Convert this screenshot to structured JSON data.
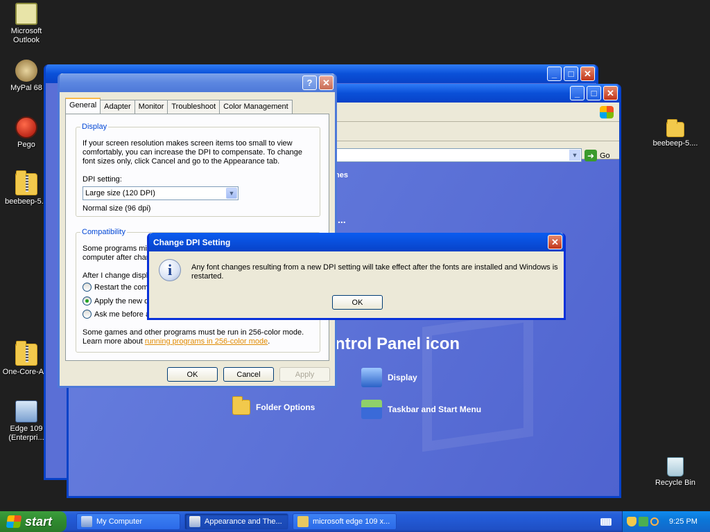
{
  "desktop": {
    "icons": [
      {
        "label": "Microsoft Outlook"
      },
      {
        "label": "MyPal 68"
      },
      {
        "label": "Pego"
      },
      {
        "label": "beebeep-5..."
      },
      {
        "label": "One-Core-A..."
      },
      {
        "label": "Edge 109 (Enterpri..."
      },
      {
        "label": "beebeep-5...."
      },
      {
        "label": "Recycle Bin"
      }
    ]
  },
  "control_panel": {
    "go_label": "Go",
    "small_heading_fragment": "nes",
    "dots": "...",
    "heading_fragment": "ntrol Panel icon",
    "links": {
      "display": "Display",
      "folder_options": "Folder Options",
      "taskbar_start": "Taskbar and Start Menu"
    }
  },
  "display_dialog": {
    "tabs": [
      "General",
      "Adapter",
      "Monitor",
      "Troubleshoot",
      "Color Management"
    ],
    "display_group": {
      "legend": "Display",
      "description": "If your screen resolution makes screen items too small to view comfortably, you can increase the DPI to compensate.  To change font sizes only, click Cancel and go to the Appearance tab.",
      "dpi_label": "DPI setting:",
      "dpi_value": "Large size (120 DPI)",
      "dpi_note": "Normal size (96 dpi)"
    },
    "compat_group": {
      "legend": "Compatibility",
      "line1": "Some programs migh",
      "line2": "computer after chan",
      "after_change": "After I change displa",
      "radio1": "Restart the comp",
      "radio2": "Apply the new di",
      "radio3": "Ask me before ap",
      "games_text": "Some games and other programs must be run in 256-color mode.",
      "learn_more_prefix": "Learn more about ",
      "learn_more_link": "running programs in 256-color mode",
      "learn_more_suffix": "."
    },
    "buttons": {
      "ok": "OK",
      "cancel": "Cancel",
      "apply": "Apply"
    }
  },
  "message_box": {
    "title": "Change DPI Setting",
    "message_line1": "Any font changes resulting from a new DPI setting will take effect after the fonts are installed and Windows is",
    "message_line2": "restarted.",
    "ok": "OK"
  },
  "taskbar": {
    "start_label": "start",
    "tasks": [
      {
        "label": "My Computer"
      },
      {
        "label": "Appearance and The..."
      },
      {
        "label": "microsoft edge 109 x..."
      }
    ],
    "clock": "9:25 PM"
  }
}
